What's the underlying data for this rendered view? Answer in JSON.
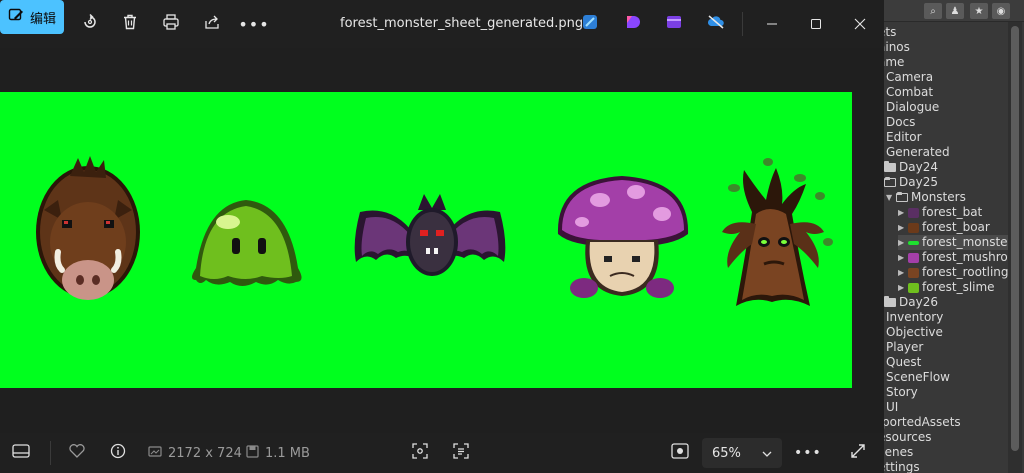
{
  "toolbar": {
    "edit_label": "编辑",
    "file_name": "forest_monster_sheet_generated.png",
    "accent": "#4cc2ff"
  },
  "statusbar": {
    "dimensions": "2172 x 724",
    "file_size": "1.1 MB",
    "zoom": "65%"
  },
  "image": {
    "background": "#00ff1e",
    "sprites": [
      "boar",
      "slime",
      "bat",
      "mushroom",
      "treant"
    ]
  },
  "tree": {
    "items": [
      {
        "label": "ets"
      },
      {
        "label": "ainos"
      },
      {
        "label": "ame"
      },
      {
        "label": "Camera"
      },
      {
        "label": "Combat"
      },
      {
        "label": "Dialogue"
      },
      {
        "label": "Docs"
      },
      {
        "label": "Editor"
      },
      {
        "label": "Generated"
      },
      {
        "label": "Day24"
      },
      {
        "label": "Day25"
      },
      {
        "label": "Monsters"
      },
      {
        "label": "forest_bat"
      },
      {
        "label": "forest_boar"
      },
      {
        "label": "forest_monste"
      },
      {
        "label": "forest_mushro"
      },
      {
        "label": "forest_rootling"
      },
      {
        "label": "forest_slime"
      },
      {
        "label": "Day26"
      },
      {
        "label": "Inventory"
      },
      {
        "label": "Objective"
      },
      {
        "label": "Player"
      },
      {
        "label": "Quest"
      },
      {
        "label": "SceneFlow"
      },
      {
        "label": "Story"
      },
      {
        "label": "UI"
      },
      {
        "label": "portedAssets"
      },
      {
        "label": "esources"
      },
      {
        "label": "cenes"
      },
      {
        "label": "ettings"
      }
    ]
  }
}
